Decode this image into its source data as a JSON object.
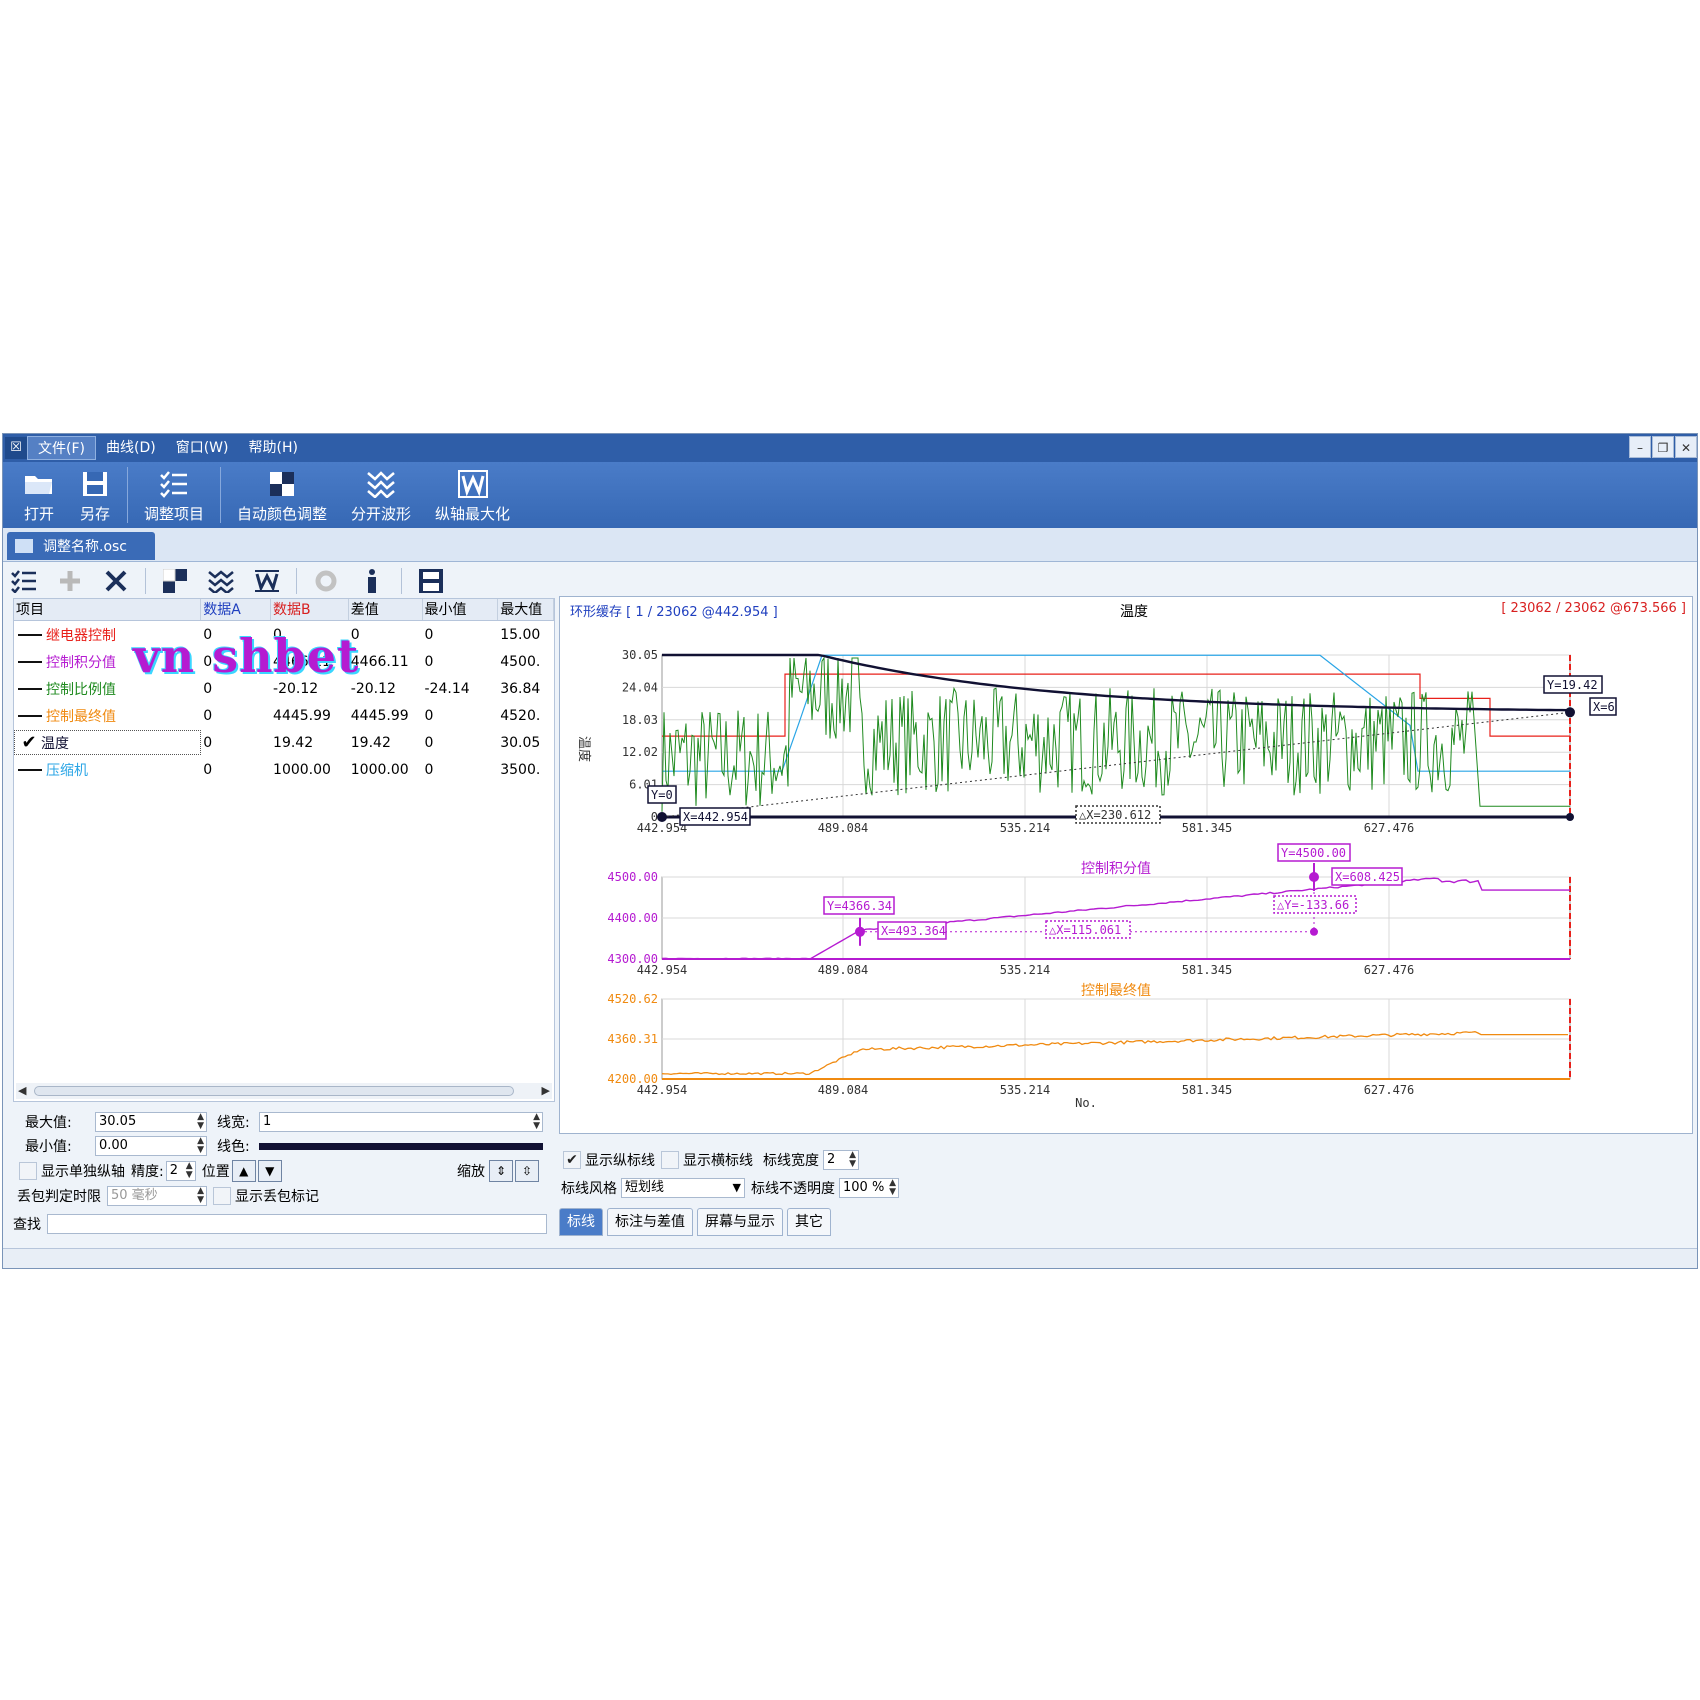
{
  "window": {
    "menus": [
      "文件(F)",
      "曲线(D)",
      "窗口(W)",
      "帮助(H)"
    ],
    "controls": [
      "–",
      "❐",
      "✕"
    ]
  },
  "ribbon": {
    "buttons": [
      {
        "label": "打开",
        "icon": "folder-open-icon"
      },
      {
        "label": "另存",
        "icon": "floppy-disk-icon"
      },
      {
        "label": "调整项目",
        "icon": "checklist-icon"
      },
      {
        "label": "自动颜色调整",
        "icon": "color-blocks-icon"
      },
      {
        "label": "分开波形",
        "icon": "separate-waves-icon"
      },
      {
        "label": "纵轴最大化",
        "icon": "maximize-axis-icon"
      }
    ]
  },
  "doc_tab": {
    "label": "调整名称.osc"
  },
  "table": {
    "headers": [
      {
        "label": "项目",
        "color": "#000000"
      },
      {
        "label": "数据A",
        "color": "#1f3fbf"
      },
      {
        "label": "数据B",
        "color": "#d81f1f"
      },
      {
        "label": "差值",
        "color": "#000000"
      },
      {
        "label": "最小值",
        "color": "#000000"
      },
      {
        "label": "最大值",
        "color": "#000000"
      }
    ],
    "rows": [
      {
        "name": "继电器控制",
        "color": "#e8201a",
        "checked": false,
        "a": "0",
        "b": "0",
        "diff": "0",
        "min": "0",
        "max": "15.00"
      },
      {
        "name": "控制积分值",
        "color": "#b51bd1",
        "checked": false,
        "a": "0",
        "b": "4466.11",
        "diff": "4466.11",
        "min": "0",
        "max": "4500."
      },
      {
        "name": "控制比例值",
        "color": "#1f8a1f",
        "checked": false,
        "a": "0",
        "b": "-20.12",
        "diff": "-20.12",
        "min": "-24.14",
        "max": "36.84"
      },
      {
        "name": "控制最终值",
        "color": "#f08a10",
        "checked": false,
        "a": "0",
        "b": "4445.99",
        "diff": "4445.99",
        "min": "0",
        "max": "4520."
      },
      {
        "name": "温度",
        "color": "#111133",
        "checked": true,
        "a": "0",
        "b": "19.42",
        "diff": "19.42",
        "min": "0",
        "max": "30.05"
      },
      {
        "name": "压缩机",
        "color": "#2aa5e6",
        "checked": false,
        "a": "0",
        "b": "1000.00",
        "diff": "1000.00",
        "min": "0",
        "max": "3500."
      }
    ]
  },
  "watermark": {
    "text": "vn shbet"
  },
  "props": {
    "max_label": "最大值:",
    "max_value": "30.05",
    "min_label": "最小值:",
    "min_value": "0.00",
    "linewidth_label": "线宽:",
    "linewidth_value": "1",
    "linecolor_label": "线色:",
    "single_axis_label": "显示单独纵轴",
    "precision_label": "精度:",
    "precision_value": "2",
    "position_label": "位置",
    "zoom_label": "缩放",
    "drop_label": "丢包判定时限",
    "drop_value": "50 毫秒",
    "show_drop_label": "显示丢包标记"
  },
  "search": {
    "label": "查找",
    "value": ""
  },
  "plot": {
    "header_left": "环形缓存 [ 1 / 23062 @442.954 ]",
    "header_center": "温度",
    "header_right": "[ 23062 / 23062 @673.566 ]",
    "x_label": "No.",
    "y_label_top": "温度",
    "x_ticks": [
      "442.954",
      "489.084",
      "535.214",
      "581.345",
      "627.476"
    ],
    "panels": [
      {
        "title": "",
        "yticks": [
          "30.05",
          "24.04",
          "18.03",
          "12.02",
          "6.01",
          "0"
        ]
      },
      {
        "title": "控制积分值",
        "yticks": [
          "4500.00",
          "4400.00",
          "4300.00"
        ]
      },
      {
        "title": "控制最终值",
        "yticks": [
          "4520.62",
          "4360.31",
          "4200.00"
        ]
      }
    ],
    "markers": {
      "p1_y0": "Y=0",
      "p1_x": "X=442.954",
      "p1_dx": "△X=230.612",
      "p1_y": "Y=19.42",
      "p1_xr": "X=6",
      "p2_ya": "Y=4366.34",
      "p2_xa": "X=493.364",
      "p2_dx": "△X=115.061",
      "p2_yb": "Y=4500.00",
      "p2_xb": "X=608.425",
      "p2_dy": "△Y=-133.66"
    }
  },
  "settings": {
    "show_vlines": "显示纵标线",
    "show_hlines": "显示横标线",
    "line_width_label": "标线宽度",
    "line_width_value": "2",
    "style_label": "标线风格",
    "style_value": "短划线",
    "opacity_label": "标线不透明度",
    "opacity_value": "100 %"
  },
  "tabs": [
    "标线",
    "标注与差值",
    "屏幕与显示",
    "其它"
  ]
}
